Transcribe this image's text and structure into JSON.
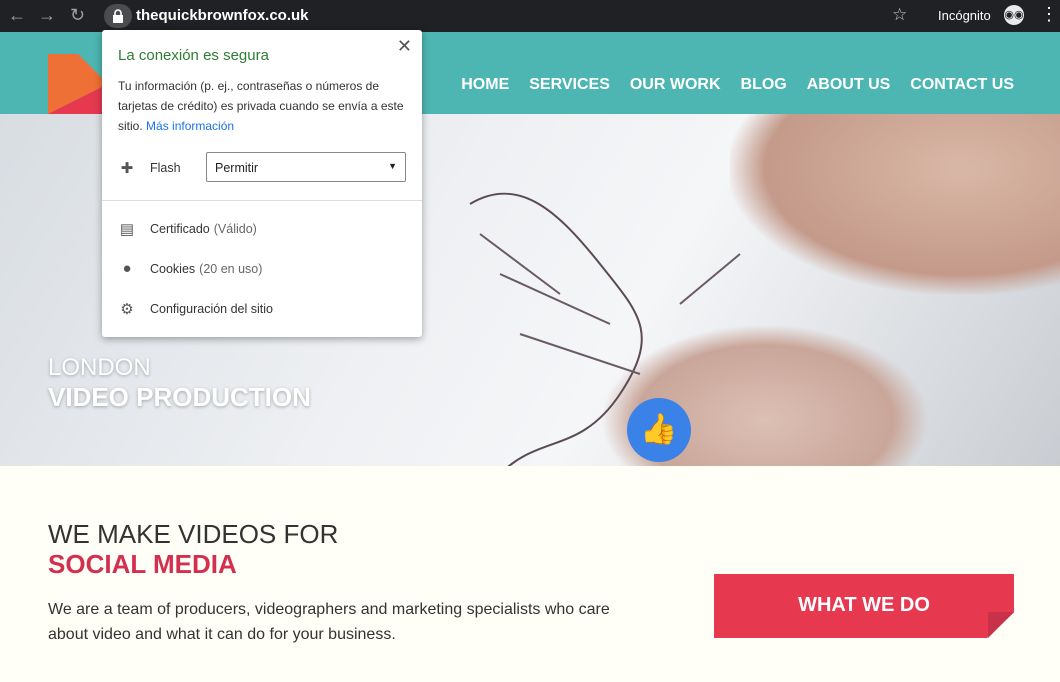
{
  "browser": {
    "url": "thequickbrownfox.co.uk",
    "incognito_label": "Incógnito"
  },
  "nav": {
    "items": [
      "HOME",
      "SERVICES",
      "OUR WORK",
      "BLOG",
      "ABOUT US",
      "CONTACT US"
    ]
  },
  "hero": {
    "line1": "LONDON",
    "line2": "VIDEO PRODUCTION"
  },
  "intro": {
    "title1": "WE MAKE VIDEOS FOR",
    "title2": "SOCIAL MEDIA",
    "paragraph": "We are a team of producers, videographers and marketing specialists who care about video and what it can do for your business.",
    "cta": "WHAT WE DO"
  },
  "colors": {
    "nav": "#4db6b2",
    "accent": "#e63950",
    "secure": "#2e7d32"
  },
  "popup": {
    "title": "La conexión es segura",
    "desc": "Tu información (p. ej., contraseñas o números de tarjetas de crédito) es privada cuando se envía a este sitio.",
    "link": "Más información",
    "flash_label": "Flash",
    "flash_value": "Permitir",
    "cert_label": "Certificado",
    "cert_status": "(Válido)",
    "cookies_label": "Cookies",
    "cookies_status": "(20 en uso)",
    "settings_label": "Configuración del sitio"
  }
}
